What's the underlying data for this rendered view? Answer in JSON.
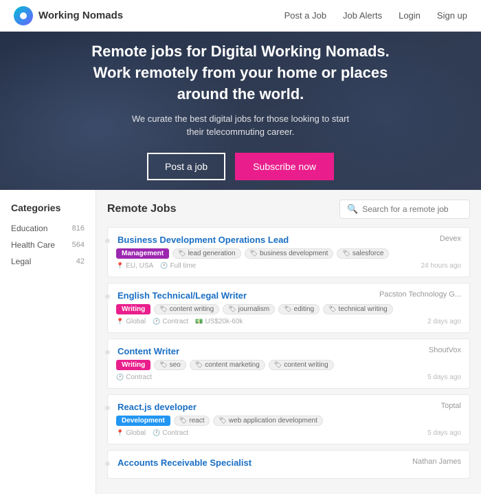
{
  "navbar": {
    "brand": "Working Nomads",
    "nav_items": [
      {
        "label": "Post a Job",
        "id": "post-job"
      },
      {
        "label": "Job Alerts",
        "id": "job-alerts"
      },
      {
        "label": "Login",
        "id": "login"
      },
      {
        "label": "Sign up",
        "id": "signup"
      }
    ]
  },
  "hero": {
    "headline": "Remote jobs for Digital Working Nomads. Work remotely from your home or places around the world.",
    "subtext": "We curate the best digital jobs for those looking to start their telecommuting career.",
    "btn_post": "Post a job",
    "btn_subscribe": "Subscribe now"
  },
  "sidebar": {
    "title": "Categories",
    "items": [
      {
        "label": "Education",
        "count": "816"
      },
      {
        "label": "Health Care",
        "count": "564"
      },
      {
        "label": "Legal",
        "count": "42"
      }
    ]
  },
  "jobs": {
    "title": "Remote Jobs",
    "search_placeholder": "Search for a remote job",
    "items": [
      {
        "title": "Business Development Operations Lead",
        "company": "Devex",
        "category": "Management",
        "category_class": "tag-management",
        "tags": [
          "lead generation",
          "business development",
          "salesforce"
        ],
        "location": "EU, USA",
        "type": "Full time",
        "salary": "",
        "time": "24 hours ago"
      },
      {
        "title": "English Technical/Legal Writer",
        "company": "Pacston Technology G...",
        "category": "Writing",
        "category_class": "tag-writing",
        "tags": [
          "content writing",
          "journalism",
          "editing",
          "technical writing"
        ],
        "location": "Global",
        "type": "Contract",
        "salary": "US$20k-60k",
        "time": "2 days ago"
      },
      {
        "title": "Content Writer",
        "company": "ShoutVox",
        "category": "Writing",
        "category_class": "tag-writing",
        "tags": [
          "seo",
          "content marketing",
          "content writing"
        ],
        "location": "",
        "type": "Contract",
        "salary": "",
        "time": "5 days ago"
      },
      {
        "title": "React.js developer",
        "company": "Toptal",
        "category": "Development",
        "category_class": "tag-development",
        "tags": [
          "react",
          "web application development"
        ],
        "location": "Global",
        "type": "Contract",
        "salary": "",
        "time": "5 days ago"
      },
      {
        "title": "Accounts Receivable Specialist",
        "company": "Nathan James",
        "category": "",
        "category_class": "",
        "tags": [],
        "location": "",
        "type": "",
        "salary": "",
        "time": ""
      }
    ]
  }
}
